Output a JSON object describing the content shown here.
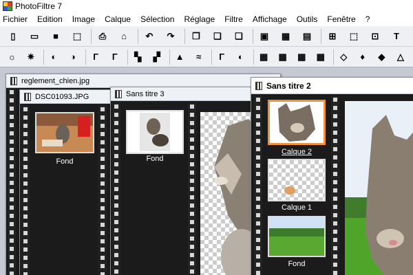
{
  "app": {
    "title": "PhotoFiltre 7"
  },
  "menu": [
    "Fichier",
    "Edition",
    "Image",
    "Calque",
    "Sélection",
    "Réglage",
    "Filtre",
    "Affichage",
    "Outils",
    "Fenêtre",
    "?"
  ],
  "toolbar1": [
    {
      "name": "new-file-icon",
      "glyph": "▯"
    },
    {
      "name": "open-folder-icon",
      "glyph": "▭"
    },
    {
      "name": "save-icon",
      "glyph": "■"
    },
    {
      "name": "import-icon",
      "glyph": "⬚"
    },
    {
      "name": "print-icon",
      "glyph": "⎙"
    },
    {
      "name": "scan-icon",
      "glyph": "⌂"
    },
    {
      "name": "undo-icon",
      "glyph": "↶"
    },
    {
      "name": "redo-icon",
      "glyph": "↷"
    },
    {
      "name": "copy-icon",
      "glyph": "❐"
    },
    {
      "name": "paste-icon",
      "glyph": "❏"
    },
    {
      "name": "paste-new-icon",
      "glyph": "❑"
    },
    {
      "name": "gradient-icon",
      "glyph": "▣"
    },
    {
      "name": "layer-transparency-icon",
      "glyph": "▦"
    },
    {
      "name": "copy-image-icon",
      "glyph": "▤"
    },
    {
      "name": "fit-image-icon",
      "glyph": "⊞"
    },
    {
      "name": "select-all-icon",
      "glyph": "⬚"
    },
    {
      "name": "crop-icon",
      "glyph": "⊡"
    },
    {
      "name": "text-icon",
      "glyph": "T"
    }
  ],
  "toolbar2": [
    {
      "name": "brightness-plus-icon",
      "glyph": "☼"
    },
    {
      "name": "brightness-minus-icon",
      "glyph": "✷"
    },
    {
      "name": "contrast-plus-icon",
      "glyph": "◐"
    },
    {
      "name": "contrast-minus-icon",
      "glyph": "◑"
    },
    {
      "name": "gamma-plus-icon",
      "glyph": "Γ"
    },
    {
      "name": "gamma-minus-icon",
      "glyph": "Γ"
    },
    {
      "name": "saturation-plus-icon",
      "glyph": "▚"
    },
    {
      "name": "saturation-minus-icon",
      "glyph": "▞"
    },
    {
      "name": "levels-icon",
      "glyph": "▲"
    },
    {
      "name": "curves-icon",
      "glyph": "≈"
    },
    {
      "name": "auto-levels-icon",
      "glyph": "Γ"
    },
    {
      "name": "auto-contrast-icon",
      "glyph": "◐"
    },
    {
      "name": "color-grid-icon",
      "glyph": "▦"
    },
    {
      "name": "color-grid-2-icon",
      "glyph": "▦"
    },
    {
      "name": "color-grid-3-icon",
      "glyph": "▦"
    },
    {
      "name": "color-grid-4-icon",
      "glyph": "▦"
    },
    {
      "name": "drop-white-icon",
      "glyph": "◇"
    },
    {
      "name": "drop-icon",
      "glyph": "♦"
    },
    {
      "name": "drop-blur-icon",
      "glyph": "◆"
    },
    {
      "name": "sharpen-icon",
      "glyph": "△"
    }
  ],
  "colors": {
    "accent": "#f0923a",
    "window_bg": "#1b1b1b",
    "mdi_bg": "#c5cad2"
  },
  "windows": {
    "reglement": {
      "title": "reglement_chien.jpg"
    },
    "dsc": {
      "title": "DSC01093.JPG",
      "layers": [
        {
          "label": "Fond"
        }
      ]
    },
    "sans3": {
      "title": "Sans titre 3",
      "layers": [
        {
          "label": "Fond"
        }
      ]
    },
    "sans2": {
      "title": "Sans titre 2",
      "layers": [
        {
          "label": "Calque 2"
        },
        {
          "label": "Calque 1"
        },
        {
          "label": "Fond"
        }
      ]
    }
  }
}
